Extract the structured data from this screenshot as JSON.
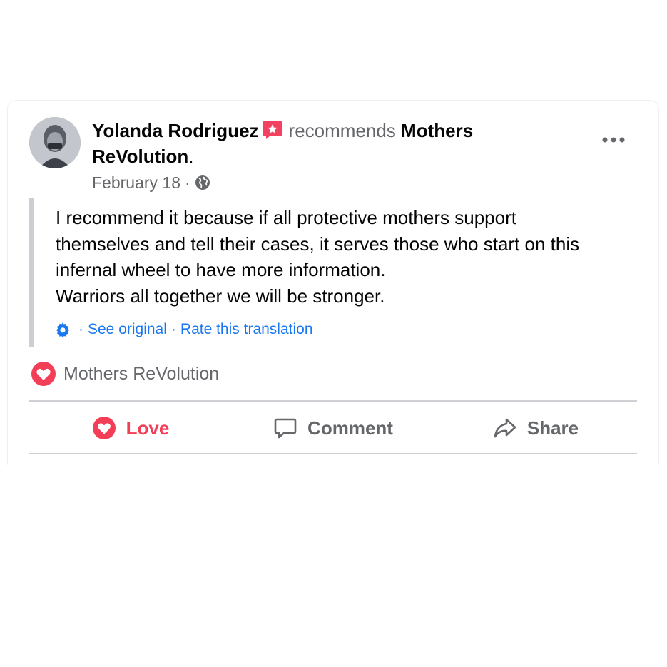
{
  "post": {
    "author": "Yolanda Rodriguez",
    "verb": "recommends",
    "target_line1": "Mothers",
    "target_line2": "ReVolution",
    "target_suffix": ".",
    "date": "February 18",
    "meta_separator": "·",
    "body_lines": [
      "I recommend it because if all protective mothers support",
      "themselves and tell their cases, it serves those who start on this",
      "infernal wheel to have more information.",
      "Warriors all together we will be stronger."
    ],
    "translation": {
      "see_original": "See original",
      "rate": "Rate this translation",
      "separator": "·"
    },
    "recommended_page": "Mothers ReVolution"
  },
  "actions": {
    "love_label": "Love",
    "comment_label": "Comment",
    "share_label": "Share"
  },
  "icons": {
    "more": "more-options-icon",
    "globe": "globe-icon",
    "gear": "gear-icon",
    "heart": "heart-icon",
    "comment": "comment-icon",
    "share": "share-icon",
    "badge": "star-badge-icon"
  },
  "colors": {
    "link_blue": "#1877f2",
    "love_red": "#f33e58",
    "secondary_text": "#65676b",
    "primary_text": "#050505"
  }
}
